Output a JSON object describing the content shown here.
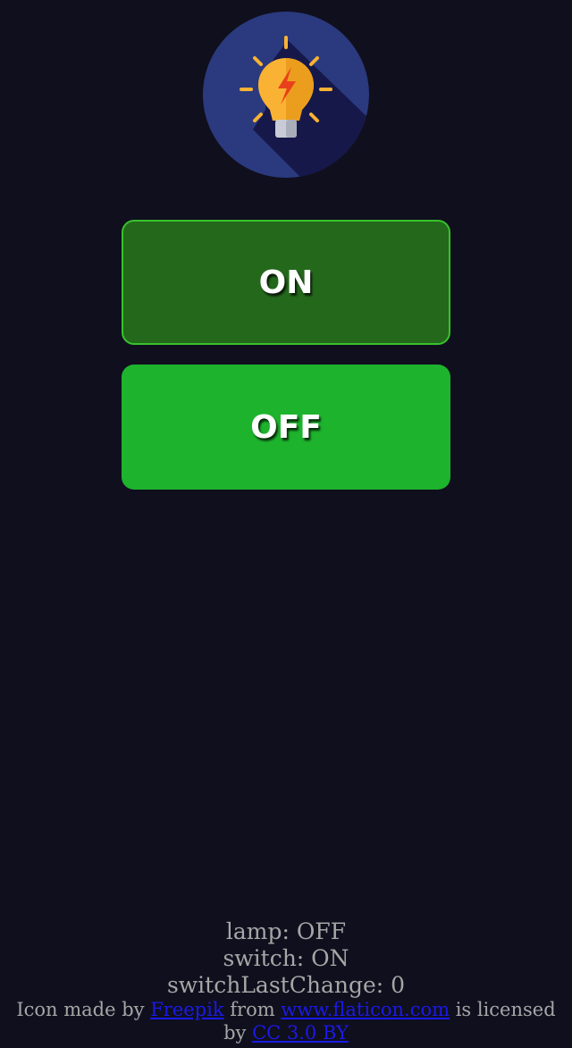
{
  "logo": {
    "icon": "lightbulb-icon",
    "bg_color": "#2b3a7e",
    "bulb_color": "#f9b233"
  },
  "buttons": {
    "on_label": "ON",
    "off_label": "OFF",
    "on_color": "#24681c",
    "off_color": "#1db32d"
  },
  "status": {
    "lamp": "lamp: OFF",
    "switch": "switch: ON",
    "switch_last_change": "switchLastChange: 0"
  },
  "credit": {
    "prefix": "Icon made by ",
    "author_link": "Freepik",
    "middle": " from ",
    "site_link": "www.flaticon.com",
    "licensed": " is licensed by ",
    "license_link": "CC 3.0 BY"
  }
}
